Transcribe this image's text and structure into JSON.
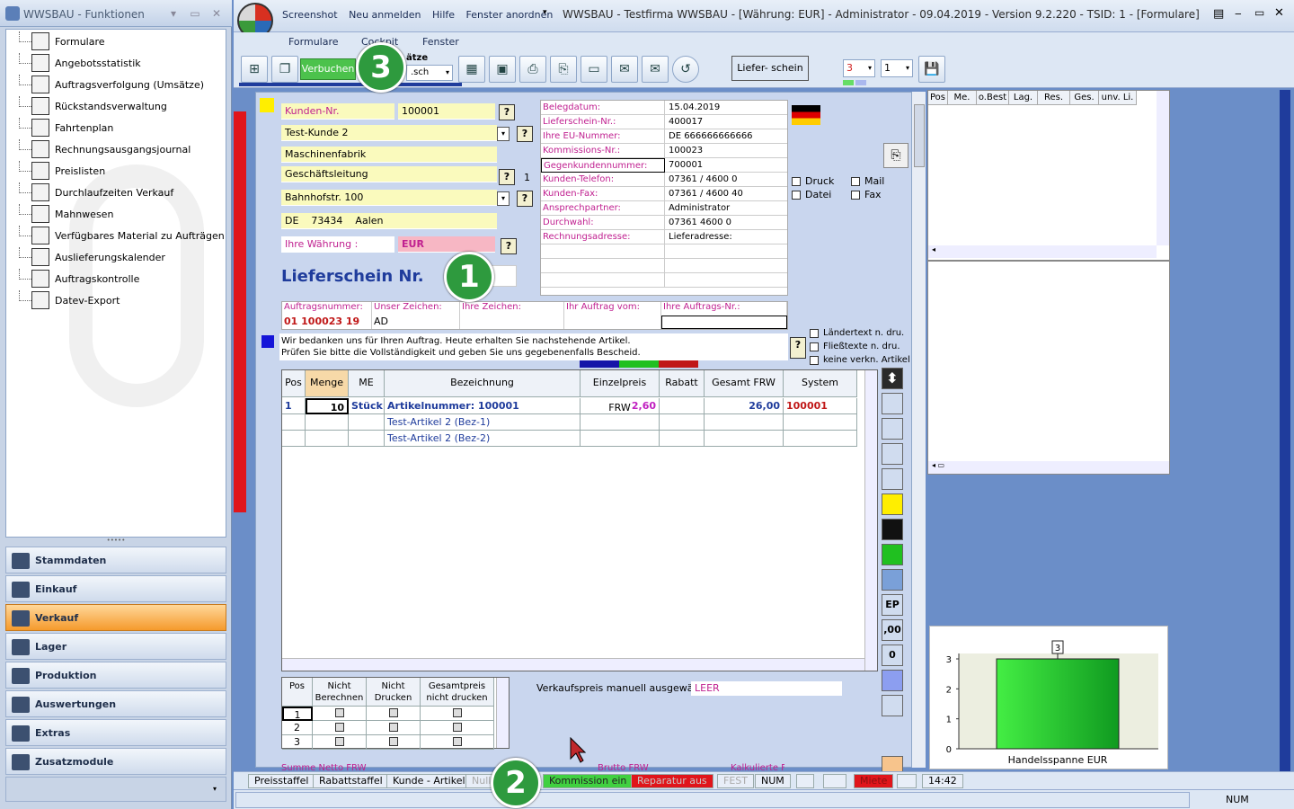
{
  "left_panel": {
    "title": "WWSBAU - Funktionen",
    "tree": [
      "Formulare",
      "Angebotsstatistik",
      "Auftragsverfolgung (Umsätze)",
      "Rückstandsverwaltung",
      "Fahrtenplan",
      "Rechnungsausgangsjournal",
      "Preislisten",
      "Durchlaufzeiten Verkauf",
      "Mahnwesen",
      "Verfügbares Material zu Aufträgen",
      "Auslieferungskalender",
      "Auftragskontrolle",
      "Datev-Export"
    ],
    "nav": [
      "Stammdaten",
      "Einkauf",
      "Verkauf",
      "Lager",
      "Produktion",
      "Auswertungen",
      "Extras",
      "Zusatzmodule"
    ],
    "active_nav": "Verkauf"
  },
  "title_bar": {
    "quick": [
      "Screenshot",
      "Neu anmelden",
      "Hilfe",
      "Fenster anordnen"
    ],
    "window_title": "WWSBAU - Testfirma WWSBAU - [Währung: EUR] - Administrator - 09.04.2019 - Version 9.2.220 - TSID: 1  - [Formulare]"
  },
  "menu": [
    "Formulare",
    "Cockpit",
    "Fenster"
  ],
  "toolbar": {
    "verbuchen": "Verbuchen",
    "saetze_label": "ätze",
    "saetze_value": ".sch",
    "liefer": "Liefer-    schein",
    "spin1": "3",
    "spin2": "1"
  },
  "badges": {
    "b1": "1",
    "b2": "2",
    "b3": "3"
  },
  "customer": {
    "kunden_nr_label": "Kunden-Nr.",
    "kunden_nr": "100001",
    "name1": "Test-Kunde 2",
    "name2": "Maschinenfabrik",
    "name3": "Geschäftsleitung",
    "street": "Bahnhofstr. 100",
    "country": "DE",
    "zip": "73434",
    "city": "Aalen",
    "count": "1",
    "currency_label": "Ihre Währung :",
    "currency": "EUR"
  },
  "doc_title": "Lieferschein  Nr.",
  "info": [
    {
      "label": "Belegdatum:",
      "value": "15.04.2019"
    },
    {
      "label": "Lieferschein-Nr.:",
      "value": "400017"
    },
    {
      "label": "Ihre EU-Nummer:",
      "value": "DE 666666666666"
    },
    {
      "label": "Kommissions-Nr.:",
      "value": "100023"
    },
    {
      "label": "Gegenkundennummer:",
      "value": "700001"
    },
    {
      "label": "Kunden-Telefon:",
      "value": "07361 / 4600 0"
    },
    {
      "label": "Kunden-Fax:",
      "value": "07361 / 4600 40"
    },
    {
      "label": "Ansprechpartner:",
      "value": "Administrator"
    },
    {
      "label": "Durchwahl:",
      "value": "07361 4600 0"
    },
    {
      "label": "Rechnungsadresse:",
      "value": "Lieferadresse:"
    }
  ],
  "output_options": [
    "Druck",
    "Mail",
    "Datei",
    "Fax"
  ],
  "order": {
    "labels": [
      "Auftragsnummer:",
      "Unser Zeichen:",
      "Ihre Zeichen:",
      "Ihr Auftrag vom:",
      "Ihre Auftrags-Nr.:"
    ],
    "values": [
      "01 100023 19",
      "AD",
      "",
      "",
      ""
    ]
  },
  "intro_text": [
    "Wir bedanken uns für Ihren Auftrag. Heute erhalten Sie nachstehende Artikel.",
    "Prüfen Sie bitte die Vollständigkeit und geben Sie uns gegebenenfalls Bescheid."
  ],
  "text_options": [
    "Ländertext  n. dru.",
    "Fließtexte n. dru.",
    "keine verkn. Artikel"
  ],
  "grid": {
    "headers": [
      "Pos",
      "Menge",
      "ME",
      "Bezeichnung",
      "Einzelpreis FRW",
      "Rabatt",
      "Gesamt FRW",
      "System"
    ],
    "rows": [
      [
        "1",
        "10",
        "Stück",
        "Artikelnummer: 100001",
        "2,60",
        "",
        "26,00",
        "100001"
      ],
      [
        "",
        "",
        "",
        "Test-Artikel 2  (Bez-1)",
        "",
        "",
        "",
        ""
      ],
      [
        "",
        "",
        "",
        "Test-Artikel 2  (Bez-2)",
        "",
        "",
        "",
        ""
      ]
    ]
  },
  "subgrid": {
    "headers": [
      "Pos",
      "Nicht Berechnen",
      "Nicht Drucken",
      "Gesamtpreis nicht drucken"
    ],
    "rows": [
      "1",
      "2",
      "3"
    ]
  },
  "vk_label": "Verkaufspreis manuell ausgewählt:",
  "vk_value": "LEER",
  "side_buttons": [
    "EP",
    ",00",
    "0"
  ],
  "right_grid_headers": [
    "Pos",
    "Me.",
    "o.Best",
    "Lag.",
    "Res.",
    "Ges.",
    "unv. Li."
  ],
  "chart_data": {
    "type": "bar",
    "categories": [
      "Handelsspanne EUR"
    ],
    "values": [
      3
    ],
    "ylim": [
      0,
      3
    ],
    "yticks": [
      "0",
      "1",
      "2",
      "3"
    ],
    "data_label": "3",
    "colors": {
      "bar": "#22c933"
    }
  },
  "status": [
    "Preisstaffel",
    "Rabattstaffel",
    "Kunde - Artikel",
    "Nullr",
    "Kommission ein",
    "Reparatur aus",
    "FEST",
    "NUM",
    "Miete",
    "14:42"
  ],
  "bottom_status": "NUM",
  "cut_text": [
    "Summe Netto FRW",
    "Brutto FRW",
    "Kalkulierte Fracht"
  ],
  "colors": {
    "accent": "#e0151b",
    "green": "#2e9a3e",
    "yellow": "#fafabd"
  }
}
